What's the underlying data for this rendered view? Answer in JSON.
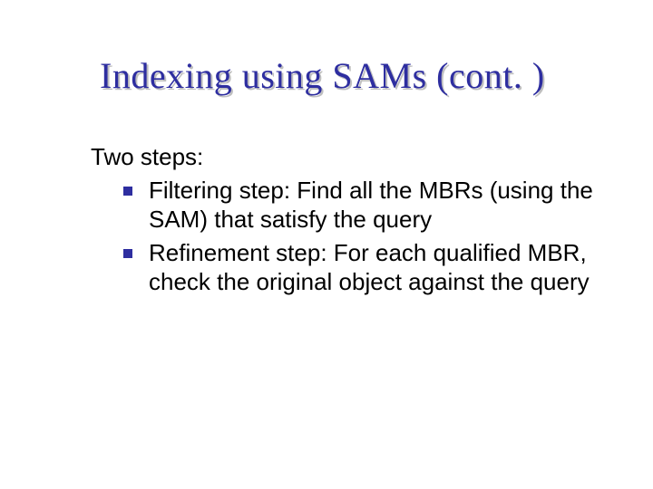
{
  "title": "Indexing using SAMs (cont. )",
  "lead": "Two steps:",
  "bullets": [
    "Filtering step: Find all the MBRs (using the SAM) that satisfy the query",
    "Refinement step: For each qualified MBR, check the original object against the query"
  ]
}
